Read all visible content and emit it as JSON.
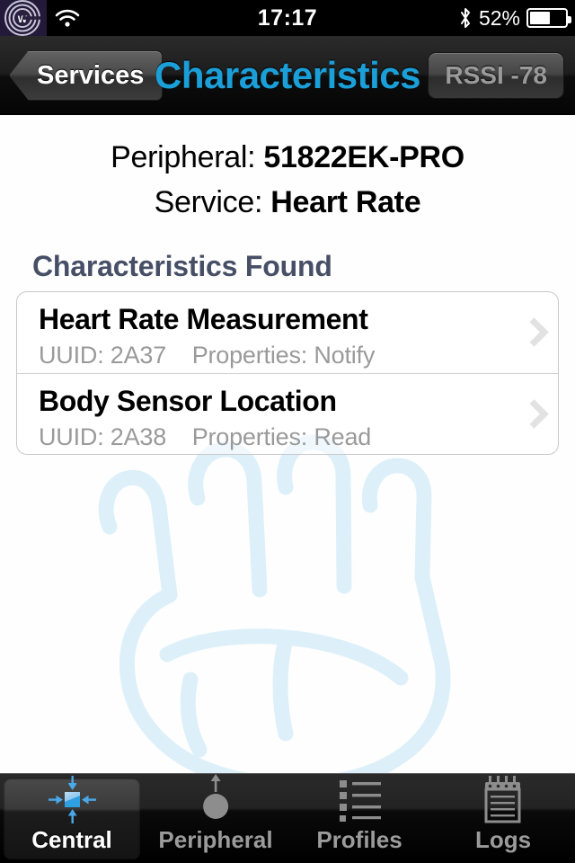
{
  "statusbar": {
    "logo_icon": "w-rings-logo-icon",
    "wifi_icon": "wifi-icon",
    "time": "17:17",
    "bluetooth_icon": "bluetooth-icon",
    "battery_percent": "52%",
    "battery_level": 52,
    "battery_icon": "battery-icon"
  },
  "navbar": {
    "back_label": "Services",
    "title": "Characteristics",
    "rssi_label": "RSSI -78",
    "title_color": "#1b9fd8"
  },
  "info": {
    "peripheral_label": "Peripheral:",
    "peripheral_value": "51822EK-PRO",
    "service_label": "Service:",
    "service_value": "Heart Rate"
  },
  "section": {
    "title": "Characteristics Found",
    "title_color": "#474f66"
  },
  "characteristics": [
    {
      "name": "Heart Rate Measurement",
      "uuid_label": "UUID: 2A37",
      "properties_label": "Properties: Notify",
      "chevron_icon": "chevron-right-icon"
    },
    {
      "name": "Body Sensor Location",
      "uuid_label": "UUID: 2A38",
      "properties_label": "Properties: Read",
      "chevron_icon": "chevron-right-icon"
    }
  ],
  "watermark": {
    "icon": "fist-watermark-icon",
    "color": "#dff0fa"
  },
  "tabs": [
    {
      "label": "Central",
      "icon": "central-arrows-icon",
      "active": true
    },
    {
      "label": "Peripheral",
      "icon": "peripheral-broadcast-icon",
      "active": false
    },
    {
      "label": "Profiles",
      "icon": "bulleted-list-icon",
      "active": false
    },
    {
      "label": "Logs",
      "icon": "notepad-icon",
      "active": false
    }
  ]
}
